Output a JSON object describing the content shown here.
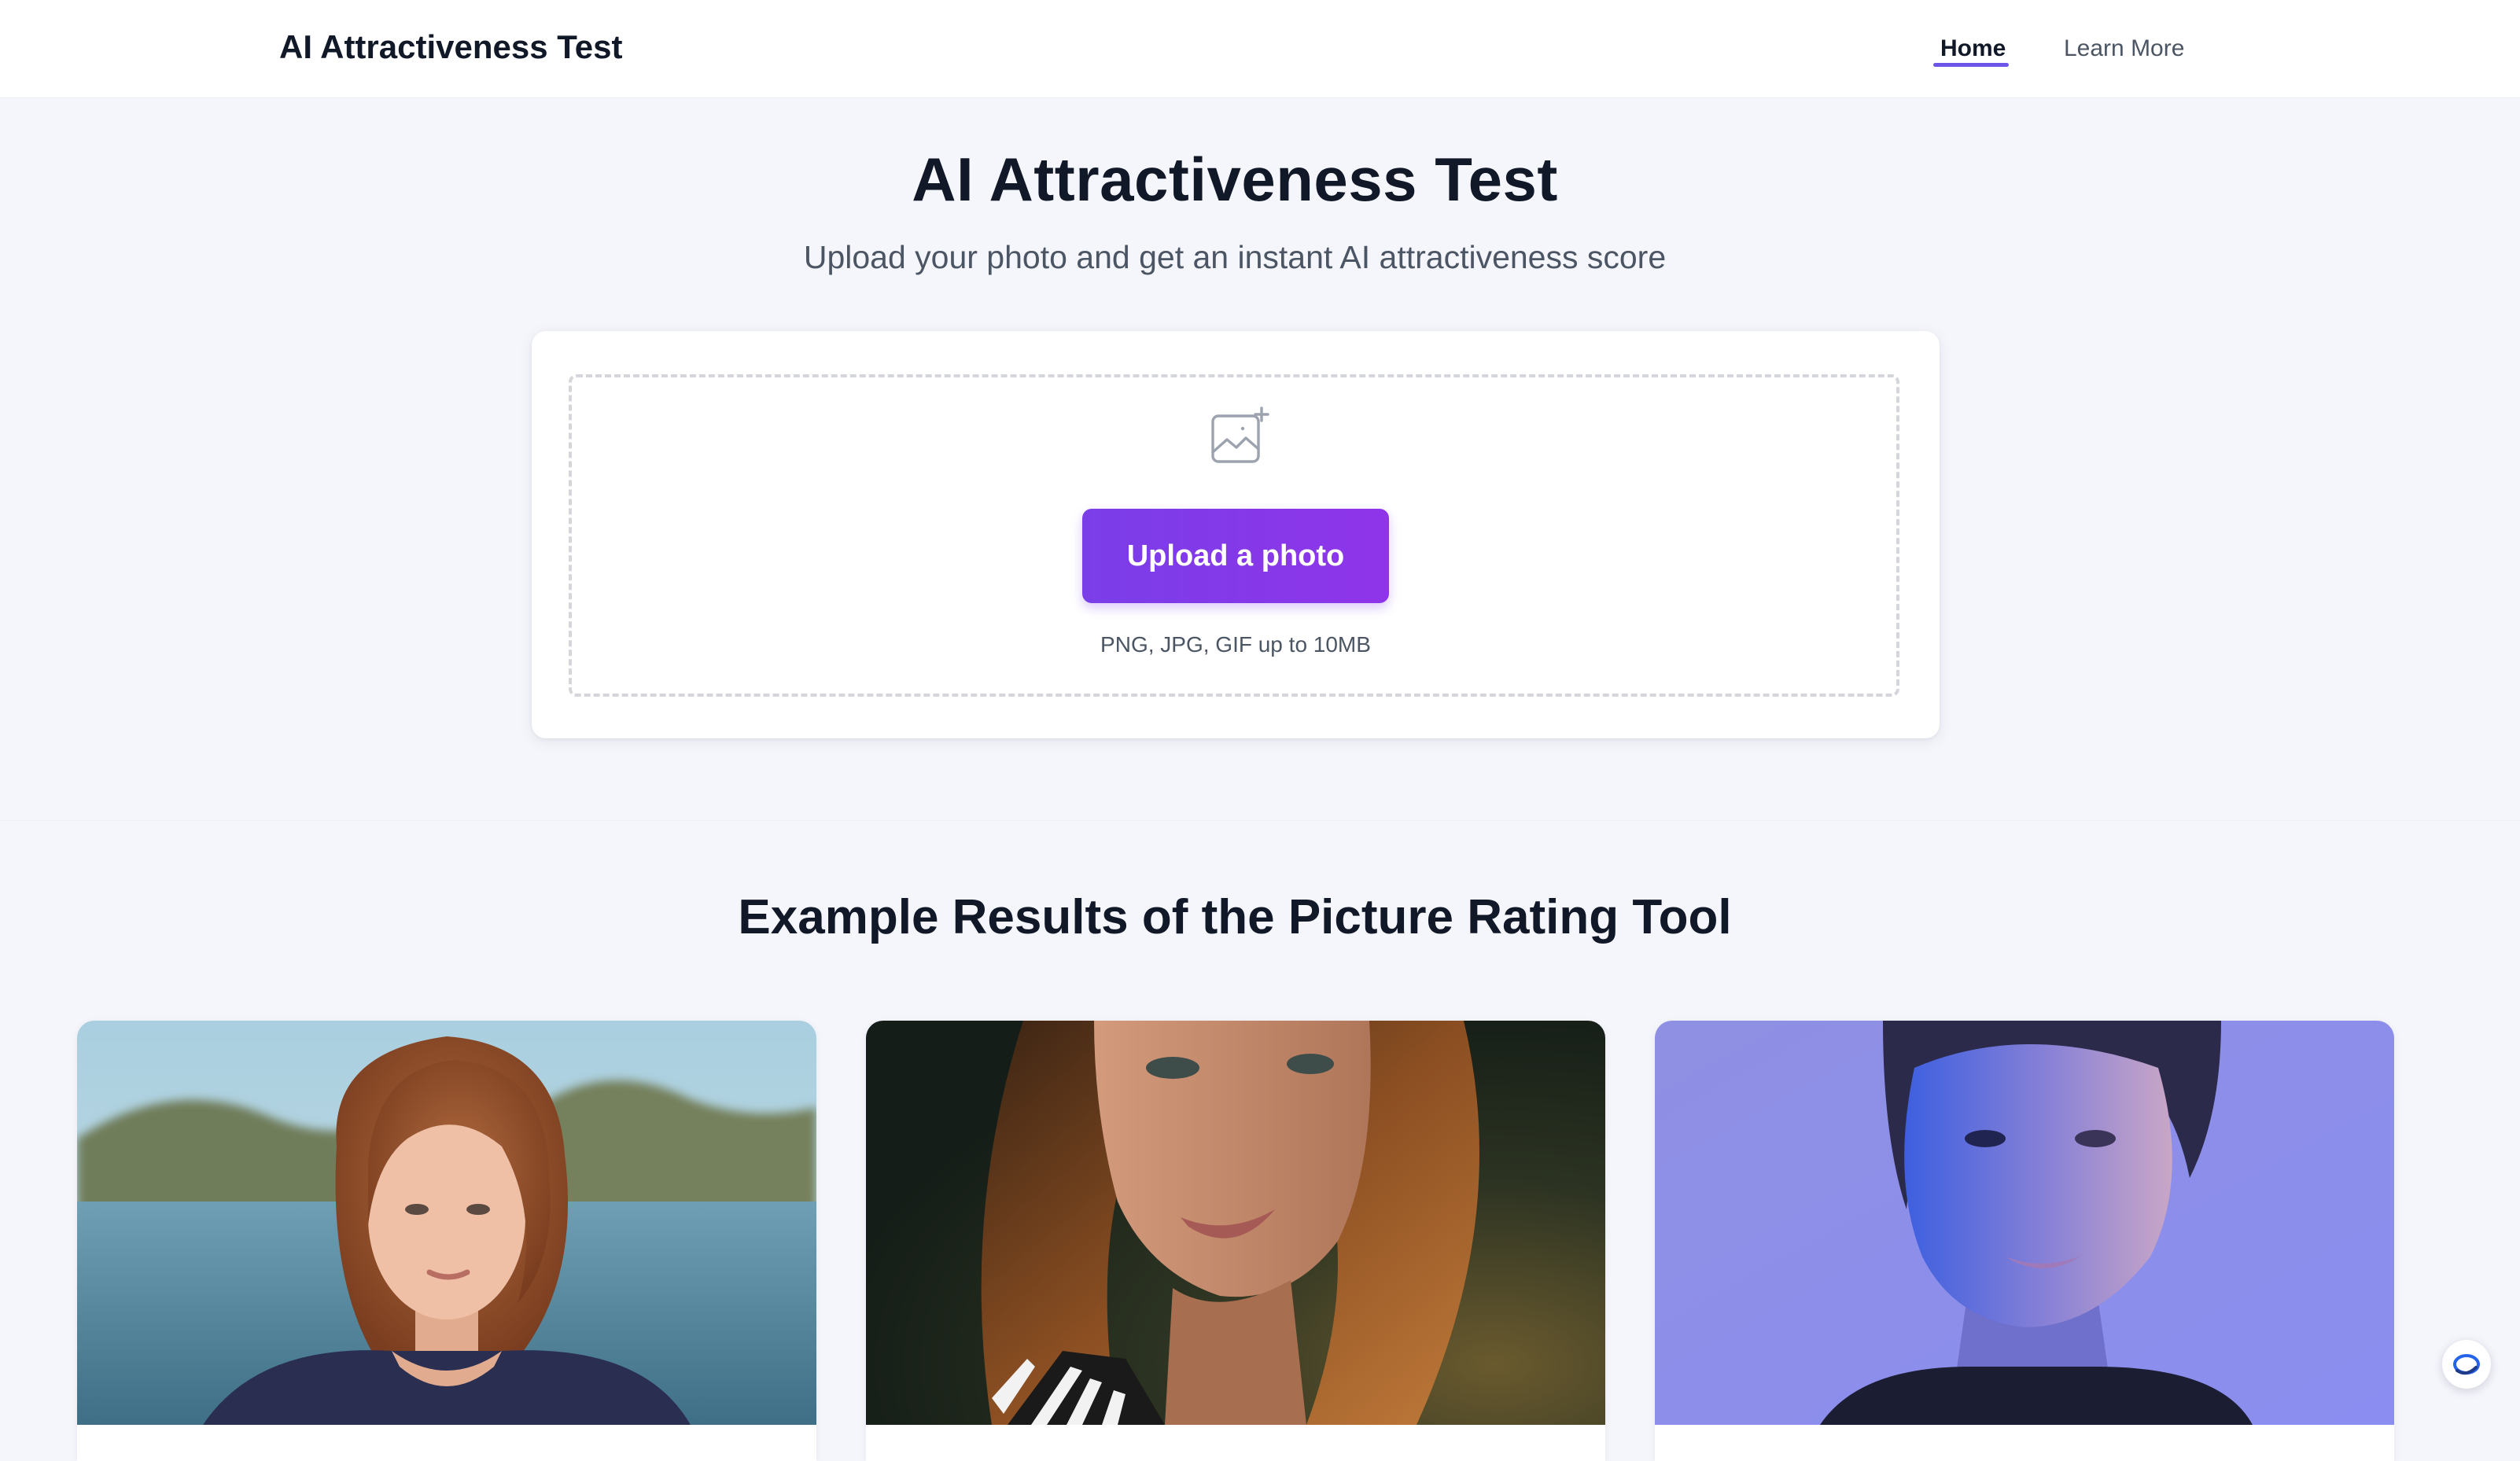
{
  "header": {
    "brand": "AI Attractiveness Test",
    "nav": [
      {
        "label": "Home",
        "active": true
      },
      {
        "label": "Learn More",
        "active": false
      }
    ]
  },
  "hero": {
    "title": "AI Attractiveness Test",
    "subtitle": "Upload your photo and get an instant AI attractiveness score"
  },
  "upload": {
    "icon": "image-plus-icon",
    "button_label": "Upload a photo",
    "hint": "PNG, JPG, GIF up to 10MB"
  },
  "examples": {
    "title": "Example Results of the Picture Rating Tool",
    "cards": [
      {
        "photo": "woman-red-hair-lake-photo"
      },
      {
        "photo": "woman-brown-hair-sunset-photo"
      },
      {
        "photo": "woman-blue-light-portrait-photo"
      }
    ]
  },
  "chat_widget": {
    "icon": "chat-assistant-icon"
  },
  "colors": {
    "accent": "#7c3aed",
    "accent_end": "#9333ea",
    "page_bg": "#f5f5fc",
    "nav_underline": "#6d55e8"
  }
}
